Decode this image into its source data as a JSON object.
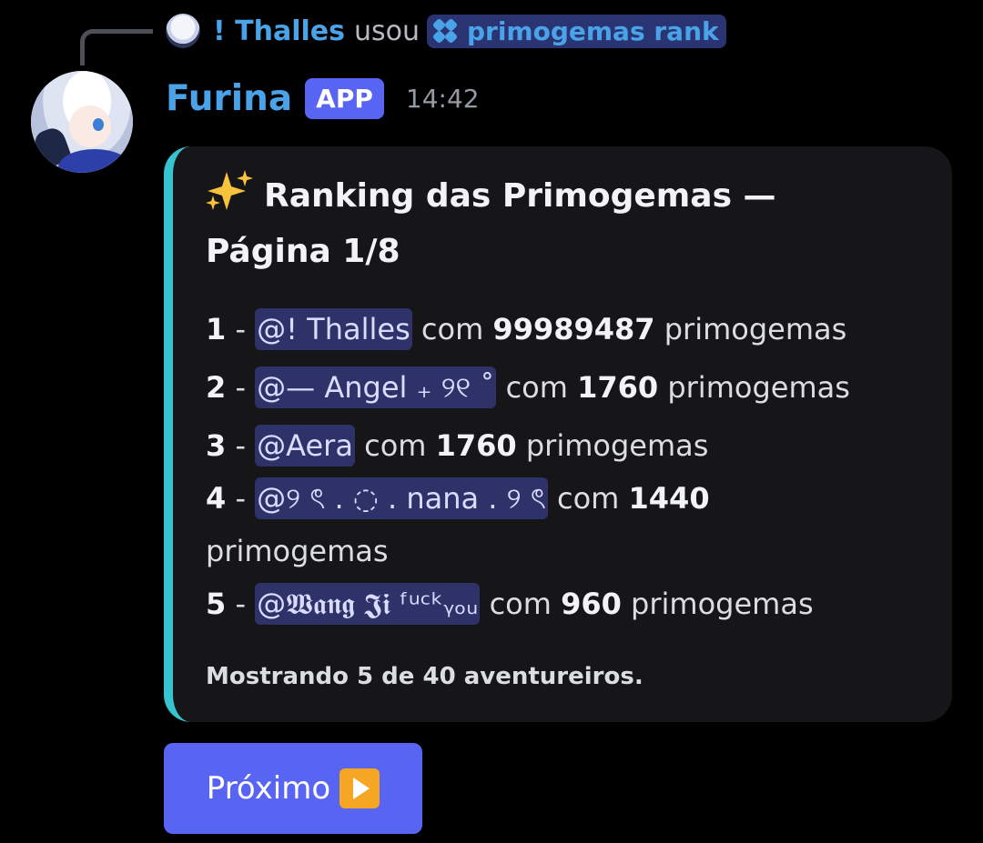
{
  "reply": {
    "user": "! Thalles",
    "verb": "usou",
    "command": "primogemas rank",
    "avatar_icon": "user-avatar-icon",
    "command_icon": "slash-command-icon"
  },
  "message": {
    "author": "Furina",
    "badge": "APP",
    "timestamp": "14:42",
    "avatar_icon": "furina-avatar-icon"
  },
  "embed": {
    "accent_color": "#36c5d0",
    "title_emoji": "sparkles-icon",
    "title": "Ranking das Primogemas — Página 1/8",
    "entries": [
      {
        "rank": "1",
        "sep": " - ",
        "mention": "@! Thalles",
        "mid": " com ",
        "value": "99989487",
        "unit": " primogemas"
      },
      {
        "rank": "2",
        "sep": " - ",
        "mention": "@— Angel ₊ ୨୧ ˚",
        "mid": " com ",
        "value": "1760",
        "unit": " primogemas"
      },
      {
        "rank": "3",
        "sep": " - ",
        "mention": "@Aera",
        "mid": " com ",
        "value": "1760",
        "unit": " primogemas"
      },
      {
        "rank": "4",
        "sep": " - ",
        "mention": "@୨ ৎ . ◌ . nana . ୨ ৎ",
        "mid": " com ",
        "value": "1440",
        "unit": " primogemas"
      },
      {
        "rank": "5",
        "sep": " - ",
        "mention": "@𝖂𝖆𝖓𝖌 𝕵𝖎 ᶠᵘᶜᵏᵧₒᵤ",
        "mid": " com ",
        "value": "960",
        "unit": " primogemas"
      }
    ],
    "footer": "Mostrando 5 de 40 aventureiros."
  },
  "button": {
    "label": "Próximo",
    "icon": "play-button-icon",
    "color": "#5865f2"
  },
  "colors": {
    "username": "#4aa3e8",
    "badge": "#5865f2",
    "mention_bg": "#2f3268"
  }
}
